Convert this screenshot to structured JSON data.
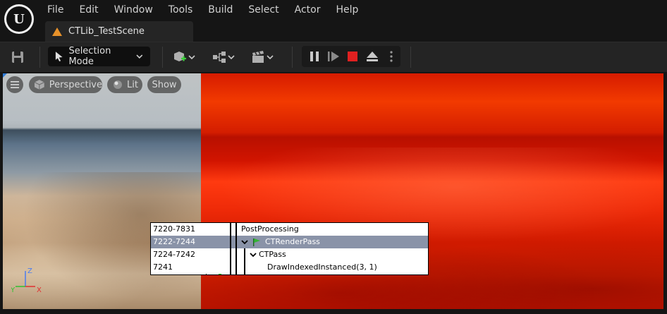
{
  "app": {
    "logo_letter": "U"
  },
  "menu": [
    "File",
    "Edit",
    "Window",
    "Tools",
    "Build",
    "Select",
    "Actor",
    "Help"
  ],
  "tab": {
    "label": "CTLib_TestScene"
  },
  "toolbar": {
    "mode_label": "Selection Mode"
  },
  "viewport": {
    "perspective_label": "Perspective",
    "lit_label": "Lit",
    "show_label": "Show"
  },
  "event_tree": [
    {
      "range": "7220-7831",
      "name": "PostProcessing"
    },
    {
      "range": "7222-7244",
      "name": "CTRenderPass",
      "selected": true
    },
    {
      "range": "7224-7242",
      "name": "CTPass"
    },
    {
      "range": "7241",
      "name": "DrawIndexedInstanced(3, 1)"
    }
  ],
  "axis": {
    "z": "Z",
    "y": "Y",
    "x": "X"
  },
  "colors": {
    "accent": "#e8922a",
    "stop": "#e02020",
    "selected_row": "#8a93a8",
    "progress": "#22d022"
  }
}
